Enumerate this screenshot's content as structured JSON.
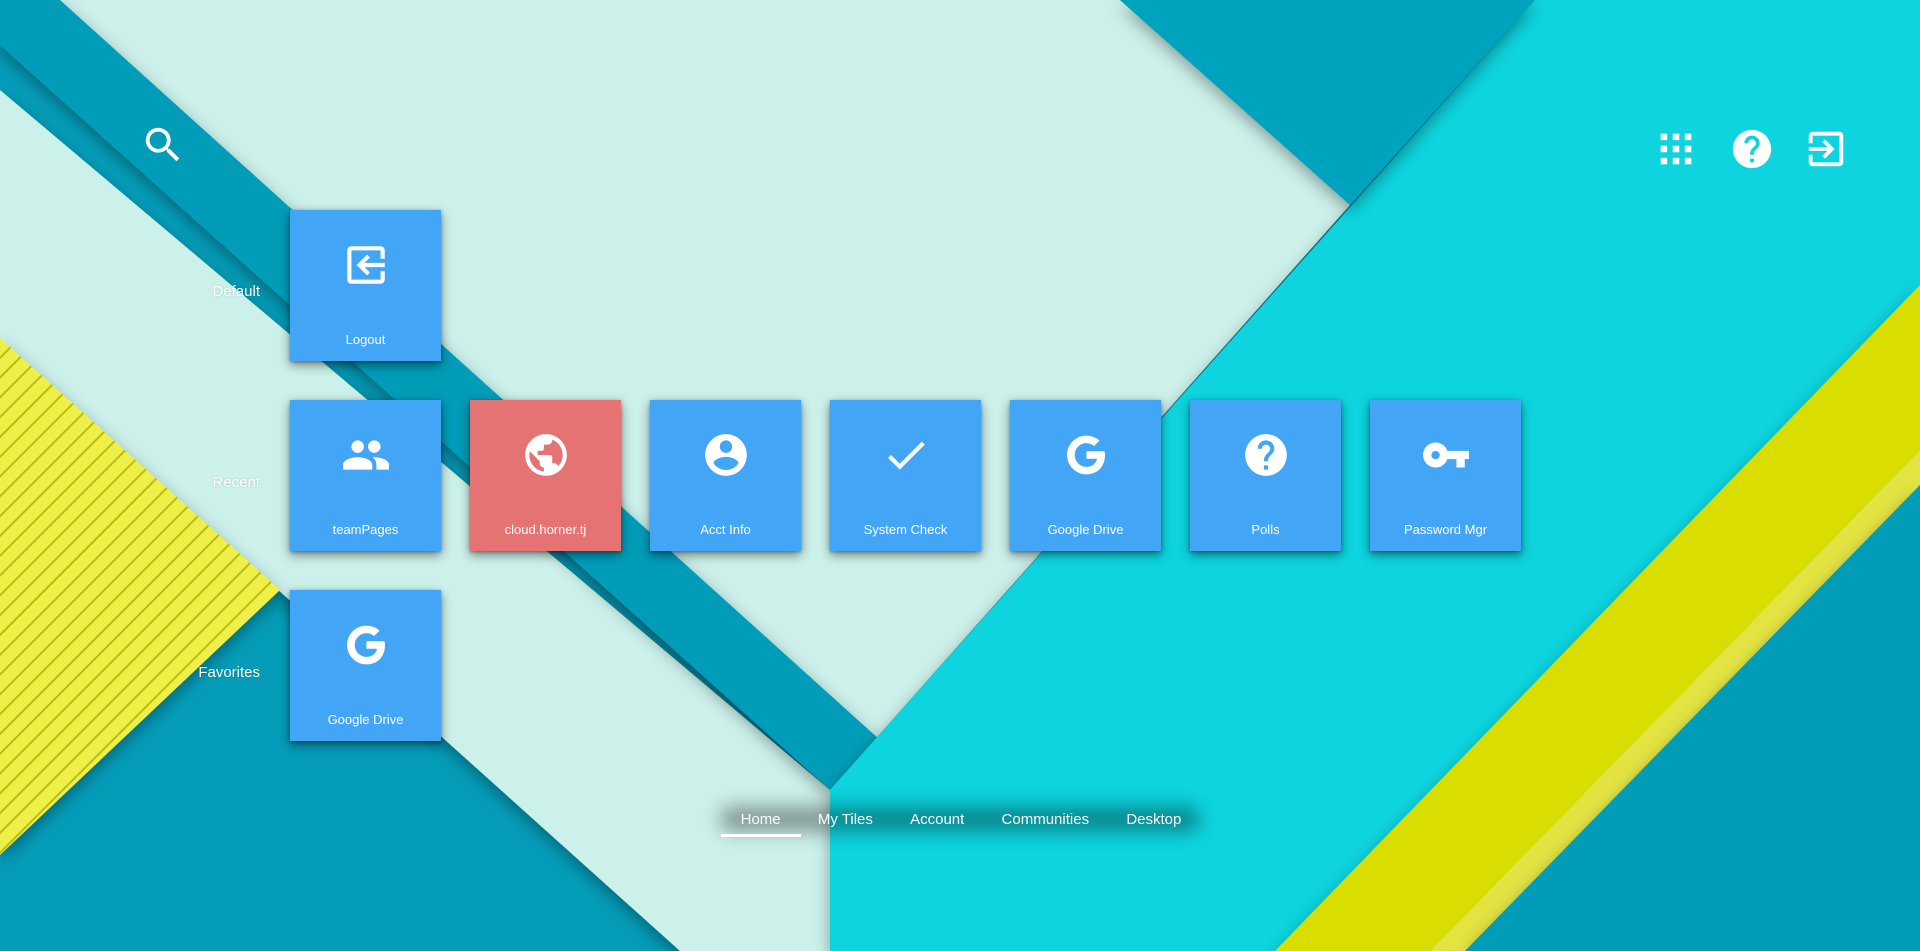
{
  "colors": {
    "tile_blue": "#42a5f5",
    "tile_red": "#e57373",
    "teal_dark": "#049cb8",
    "cyan": "#11d4de",
    "mint": "#ccf0ea",
    "yellow": "#d9de06",
    "text": "#ffffff"
  },
  "header": {
    "search_icon": "search-icon",
    "apps_icon": "apps-grid-icon",
    "help_icon": "help-icon",
    "logout_icon": "logout-icon"
  },
  "rows": [
    {
      "label": "Default",
      "tiles": [
        {
          "label": "Logout",
          "icon": "logout-icon"
        }
      ]
    },
    {
      "label": "Recent",
      "tiles": [
        {
          "label": "teamPages",
          "icon": "group-icon"
        },
        {
          "label": "cloud.horner.tj",
          "icon": "globe-icon",
          "color": "#e57373"
        },
        {
          "label": "Acct Info",
          "icon": "account-circle-icon"
        },
        {
          "label": "System Check",
          "icon": "check-icon"
        },
        {
          "label": "Google Drive",
          "icon": "google-icon"
        },
        {
          "label": "Polls",
          "icon": "help-icon"
        },
        {
          "label": "Password Mgr",
          "icon": "key-icon"
        }
      ]
    },
    {
      "label": "Favorites",
      "tiles": [
        {
          "label": "Google Drive",
          "icon": "google-icon"
        }
      ]
    }
  ],
  "nav": {
    "tabs": [
      {
        "label": "Home",
        "active": true
      },
      {
        "label": "My Tiles"
      },
      {
        "label": "Account"
      },
      {
        "label": "Communities"
      },
      {
        "label": "Desktop"
      }
    ]
  }
}
